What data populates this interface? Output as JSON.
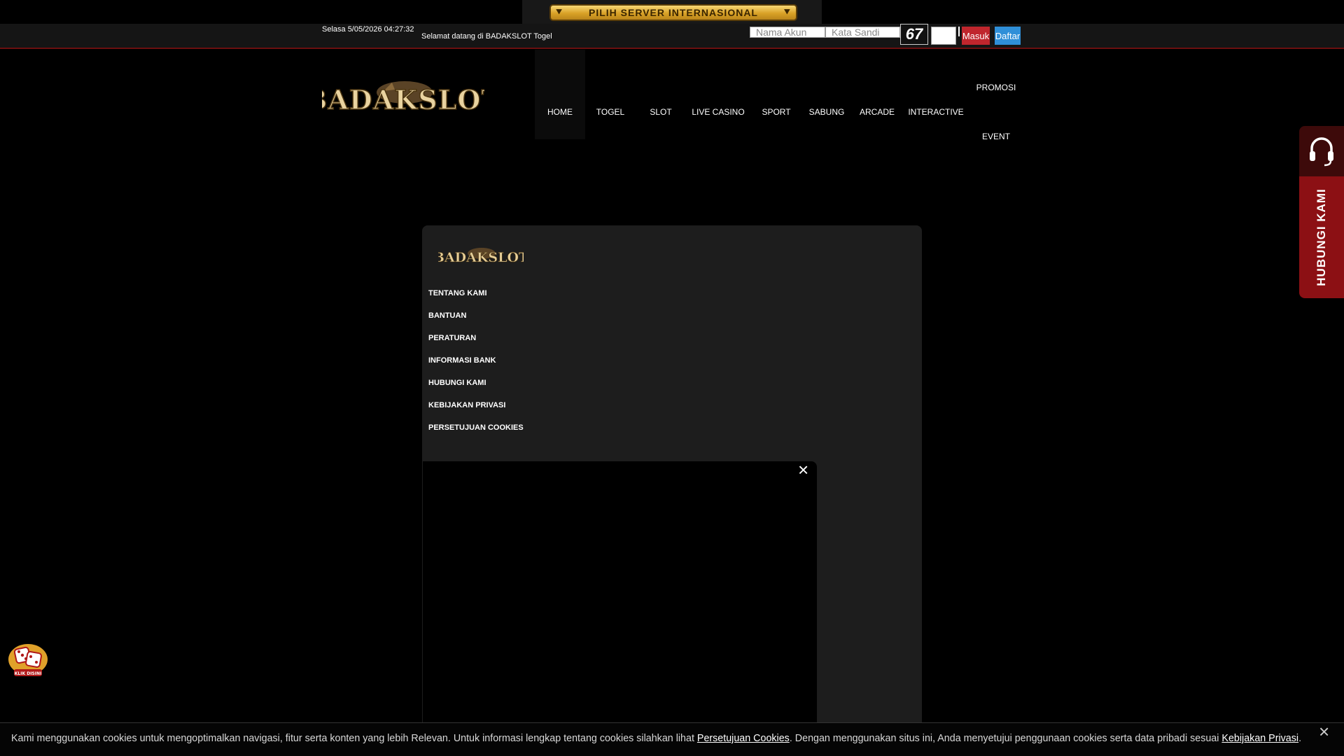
{
  "top_bar": {
    "server_button_label": "PILIH SERVER INTERNASIONAL",
    "server_button_color": "#d9a227"
  },
  "header": {
    "datetime": "Selasa 5/05/2026 04:27:32",
    "datetime_icon": "",
    "welcome": "Selamat datang di BADAKSLOT Togel",
    "username_placeholder": "Nama Akun",
    "password_placeholder": "Kata Sandi",
    "captcha_value": "67",
    "login_label": "Masuk",
    "login_color": "#c0262d",
    "register_label": "Daftar",
    "register_color": "#2f8fd8"
  },
  "logo_text": "BADAKSLOT",
  "nav": {
    "items": [
      "HOME",
      "TOGEL",
      "SLOT",
      "LIVE CASINO",
      "SPORT",
      "SABUNG",
      "ARCADE",
      "INTERACTIVE",
      "PROMOSI",
      "EVENT"
    ]
  },
  "footer_menu": {
    "logo_text": "BADAKSLOT",
    "links": [
      "TENTANG KAMI",
      "BANTUAN",
      "PERATURAN",
      "INFORMASI BANK",
      "HUBUNGI KAMI",
      "KEBIJAKAN PRIVASI",
      "PERSETUJUAN COOKIES"
    ]
  },
  "popup": {
    "close_icon": "×"
  },
  "side_contact": {
    "icon": "headset-icon",
    "label": "HUBUNGI KAMI",
    "accent_color": "#8c1014"
  },
  "promo_icon": "dice-promo-icon",
  "promo_text": "KLIK DISINI",
  "cookie": {
    "text_before": "Kami menggunakan cookies untuk mengoptimalkan navigasi, fitur serta konten yang lebih Relevan. Untuk informasi lengkap tentang cookies silahkan lihat ",
    "link1": "Persetujuan Cookies",
    "text_middle": ". Dengan menggunakan situs ini, Anda menyetujui penggunaan cookies serta data pribadi sesuai ",
    "link2": "Kebijakan Privasi",
    "text_after": ".",
    "close_icon": "×"
  }
}
